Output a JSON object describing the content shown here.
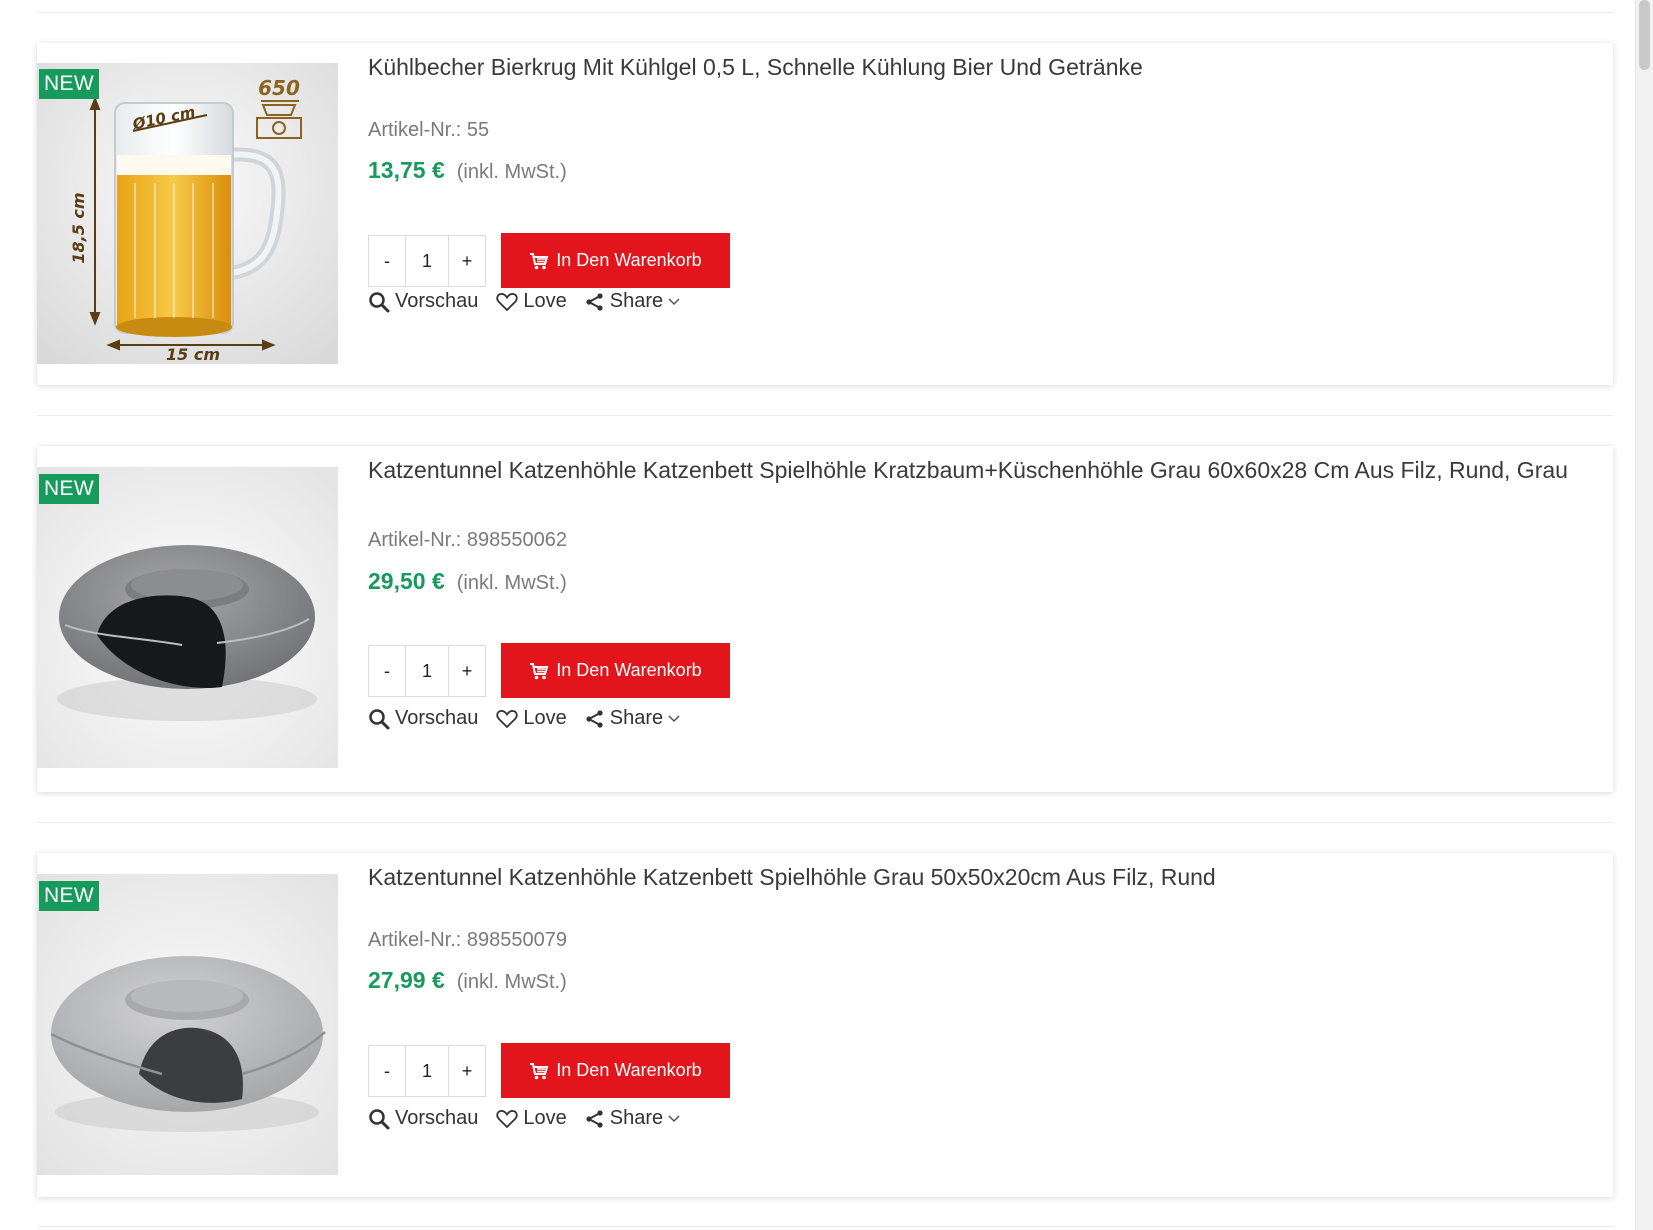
{
  "badge_label": "NEW",
  "products": [
    {
      "title": "Kühlbecher Bierkrug Mit Kühlgel 0,5 L, Schnelle Kühlung Bier Und Getränke",
      "sku": "Artikel-Nr.: 55",
      "price": "13,75 €",
      "tax_note": "(inkl. MwSt.)",
      "quantity": "1",
      "image_labels": {
        "diameter": "Ø10 cm",
        "height": "18,5 cm",
        "width": "15 cm",
        "weight": "650"
      }
    },
    {
      "title": "Katzentunnel Katzenhöhle Katzenbett Spielhöhle Kratzbaum+Küschenhöhle Grau 60x60x28 Cm Aus Filz, Rund, Grau",
      "sku": "Artikel-Nr.: 898550062",
      "price": "29,50 €",
      "tax_note": "(inkl. MwSt.)",
      "quantity": "1"
    },
    {
      "title": "Katzentunnel Katzenhöhle Katzenbett Spielhöhle Grau 50x50x20cm Aus Filz, Rund",
      "sku": "Artikel-Nr.: 898550079",
      "price": "27,99 €",
      "tax_note": "(inkl. MwSt.)",
      "quantity": "1"
    }
  ],
  "buttons": {
    "minus": "-",
    "plus": "+",
    "add_to_cart": "In Den Warenkorb",
    "preview": "Vorschau",
    "love": "Love",
    "share": "Share"
  },
  "colors": {
    "price_green": "#179b5c",
    "badge_green": "#179b5c",
    "cart_red": "#e3151c"
  },
  "icons": [
    "cart-icon",
    "search-icon",
    "heart-icon",
    "share-icon",
    "chevron-down-icon"
  ]
}
